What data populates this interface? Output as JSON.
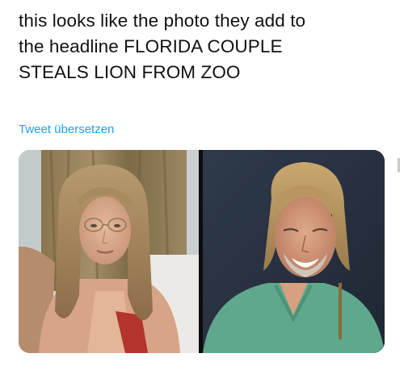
{
  "tweet": {
    "lines": [
      "this looks like the photo they add to",
      "the headline FLORIDA COUPLE",
      "STEALS LION FROM ZOO"
    ],
    "translate_label": "Tweet übersetzen"
  },
  "colors": {
    "text": "#111111",
    "link": "#1da1f2",
    "background": "#ffffff"
  }
}
